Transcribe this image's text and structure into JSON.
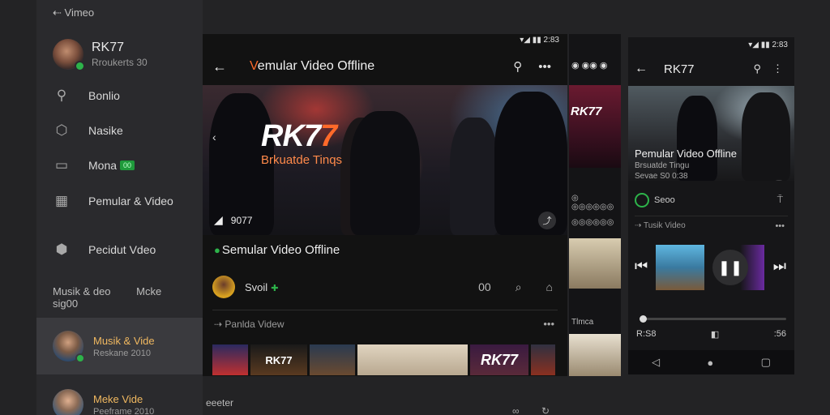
{
  "sidebar": {
    "top_label": "Vimeo",
    "top_icon": "back-arrow-icon",
    "profile": {
      "name": "RK77",
      "sub": "Rroukerts 30"
    },
    "items": [
      {
        "label": "Bonlio",
        "icon": "search-icon"
      },
      {
        "label": "Nasike",
        "icon": "folder-icon"
      },
      {
        "label": "Mona",
        "icon": "list-icon",
        "badge": "00"
      },
      {
        "label": "Pemular & Video",
        "icon": "library-icon"
      },
      {
        "label": "Pecidut Vdeo",
        "icon": "shield-icon"
      }
    ],
    "tabs": [
      "Musik & deo",
      "Mcke sig00"
    ],
    "rows": [
      {
        "title": "Musik & Vide",
        "sub": "Reskane 2010",
        "active": true
      },
      {
        "title": "Meke Vide",
        "sub": "Peeframe 2010",
        "active": false
      }
    ]
  },
  "main": {
    "status": "▾◢ ▮▮ 2:83",
    "title_first": "V",
    "title_rest": "emular Video Offline",
    "hero": {
      "title_main": "RK7",
      "title_accent": "7",
      "subtitle": "Brkuatde Tinqs",
      "left_icon": "chevron-left-icon",
      "label": "9077"
    },
    "video_title": "Semular Video Offline",
    "channel": {
      "name": "Svoil",
      "verified_icon": "verified-icon"
    },
    "actions": [
      "00",
      "comment-icon",
      "share-icon"
    ],
    "section_title": "Panlda Videw",
    "thumbnails": [
      "",
      "RK77",
      "",
      "",
      "RK77",
      ""
    ],
    "bottom_text": "eeeter"
  },
  "middle": {
    "status": "◉ ◉◉ ◉",
    "hero_text": "RK77",
    "lines": [
      "◎ ◎◎◎◎◎◎",
      "◎◎◎◎◎◎",
      "Tlmca"
    ]
  },
  "phone": {
    "status": "▾◢ ▮▮ 2:83",
    "title": "RK77",
    "video_title": "Pemular Video Offline",
    "sub1": "Brsuatde Tingu",
    "sub2": "Sevae S0 0:38",
    "channel": "Seoo",
    "section": "Tusik Video",
    "progress": 0.0,
    "time_start": "R:S8",
    "time_end": ":56"
  },
  "colors": {
    "accent": "#ff6a2a",
    "green": "#2db34a",
    "bg": "#232325"
  }
}
